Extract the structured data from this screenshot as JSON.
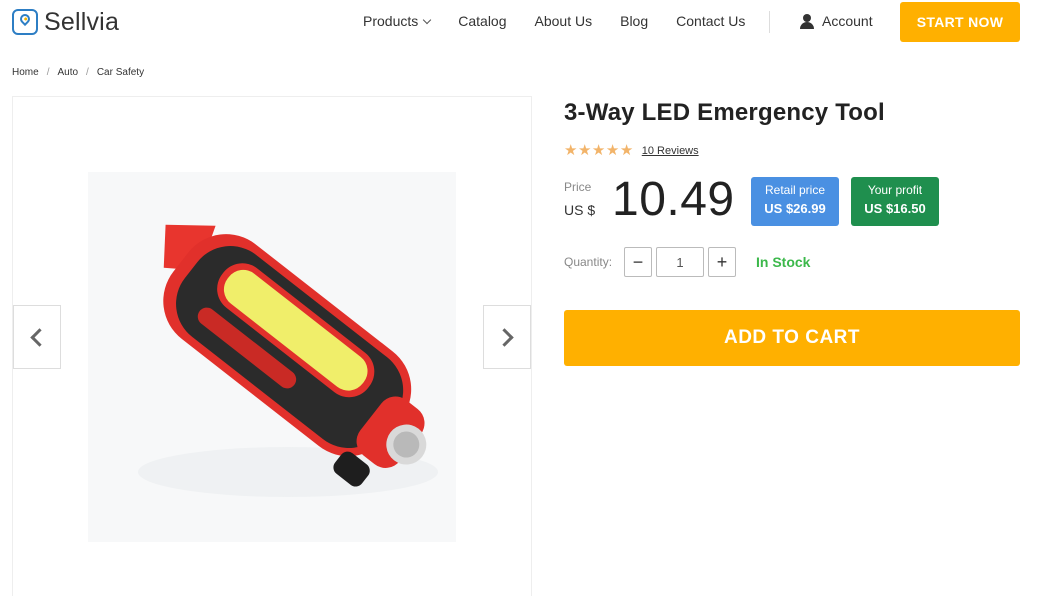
{
  "header": {
    "logo_text": "Sellvia",
    "nav": {
      "products": "Products",
      "catalog": "Catalog",
      "about": "About Us",
      "blog": "Blog",
      "contact": "Contact Us"
    },
    "account_label": "Account",
    "cta_label": "START NOW"
  },
  "breadcrumb": {
    "items": [
      "Home",
      "Auto",
      "Car Safety"
    ],
    "separator": "/"
  },
  "product": {
    "title": "3-Way LED Emergency Tool",
    "rating_stars": 5,
    "reviews_label": "10 Reviews",
    "price_label": "Price",
    "currency": "US $",
    "price": "10.49",
    "retail": {
      "label": "Retail price",
      "value": "US $26.99"
    },
    "profit": {
      "label": "Your profit",
      "value": "US $16.50"
    },
    "quantity_label": "Quantity:",
    "quantity_value": "1",
    "stock_status": "In Stock",
    "add_to_cart_label": "ADD TO CART"
  },
  "colors": {
    "accent": "#ffb000",
    "brand_blue": "#2d7ec4",
    "retail_badge": "#4a90e2",
    "profit_badge": "#1f8f4e",
    "in_stock": "#3cb84b",
    "star": "#f2b46a"
  },
  "icons": {
    "products_dropdown": "chevron-down-icon",
    "account": "user-icon",
    "gallery_prev": "chevron-left-icon",
    "gallery_next": "chevron-right-icon",
    "star": "star-icon"
  }
}
